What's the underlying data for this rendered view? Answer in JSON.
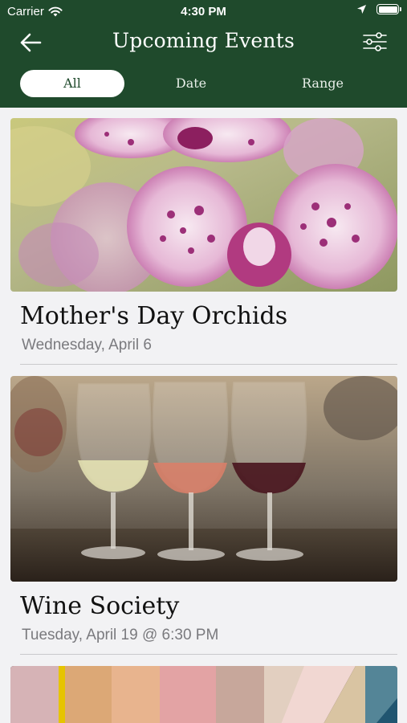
{
  "status_bar": {
    "carrier": "Carrier",
    "time": "4:30 PM",
    "icons": [
      "wifi-icon",
      "location-arrow-icon",
      "battery-icon"
    ]
  },
  "nav": {
    "title": "Upcoming Events",
    "back_icon": "arrow-left-icon",
    "filter_icon": "sliders-icon"
  },
  "segments": {
    "all": "All",
    "date": "Date",
    "range": "Range",
    "selected": "All"
  },
  "events": [
    {
      "title": "Mother's Day Orchids",
      "date": "Wednesday, April 6",
      "image": "orchid-photo"
    },
    {
      "title": "Wine Society",
      "date": "Tuesday, April 19 @ 6:30 PM",
      "image": "wine-glasses-photo"
    },
    {
      "title": "",
      "date": "",
      "image": "books-photo"
    }
  ],
  "colors": {
    "header_bg": "#1f4a2c",
    "page_bg": "#f2f2f4",
    "segment_selected_bg": "#ffffff",
    "title_text": "#111111",
    "date_text": "#7a7a7e"
  }
}
